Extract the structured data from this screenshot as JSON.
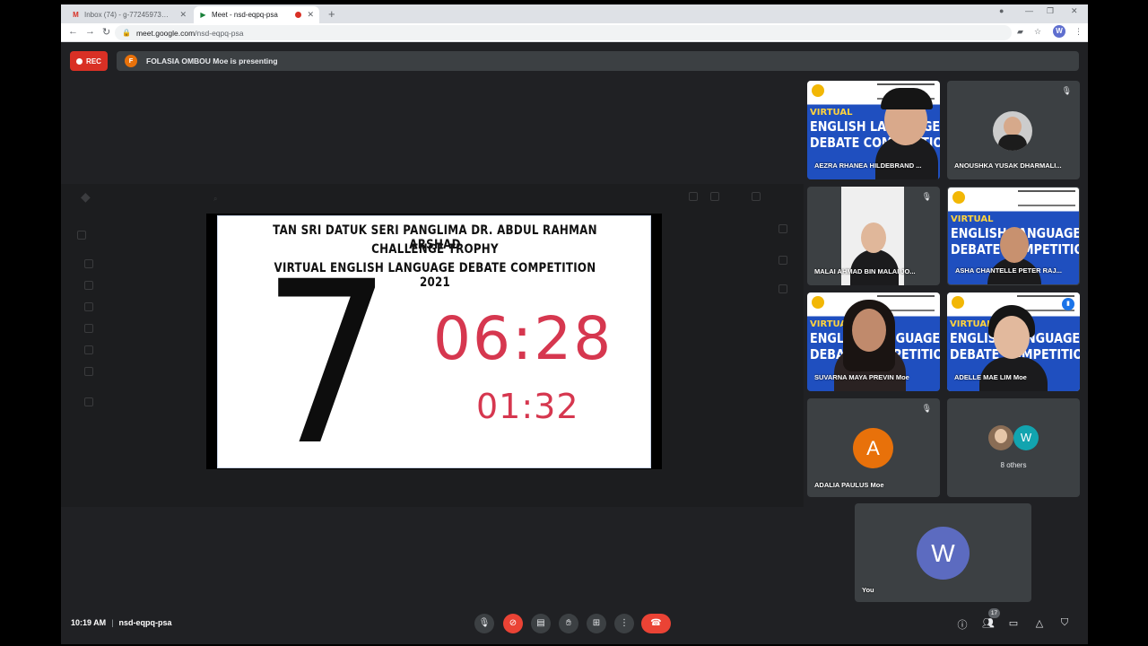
{
  "browser": {
    "tabs": [
      {
        "title": "Inbox (74) - g-77245973@moe-...",
        "favicon": "M"
      },
      {
        "title": "Meet - nsd-eqpq-psa",
        "favicon": "▶"
      }
    ],
    "url_host": "meet.google.com",
    "url_path": "/nsd-eqpq-psa",
    "profile_initial": "W"
  },
  "meet": {
    "rec_label": "REC",
    "presenter_initial": "F",
    "presenting_text": "FOLASIA OMBOU Moe is presenting",
    "meeting_code": "nsd-eqpq-psa",
    "time": "10:19 AM",
    "participant_count": "17"
  },
  "slide": {
    "line1": "TAN SRI DATUK SERI PANGLIMA DR. ABDUL RAHMAN ARSHAD",
    "line2": "CHALLENGE TROPHY",
    "line3": "VIRTUAL ENGLISH LANGUAGE DEBATE COMPETITION 2021",
    "counter": "7",
    "timer_main": "06:28",
    "timer_sub": "01:32"
  },
  "banner": {
    "w1": "VIRTUAL",
    "w2": "ENGLISH LANGUAGE",
    "w3": "DEBATE COMPETITION"
  },
  "participants": [
    {
      "name": "AEZRA RHANEA HILDEBRAND ..."
    },
    {
      "name": "ANOUSHKA YUSAK DHARMALI..."
    },
    {
      "name": "MALAI AHMAD BIN MALAI JO..."
    },
    {
      "name": "ASHA CHANTELLE PETER RAJ..."
    },
    {
      "name": "SUVARNA MAYA PREVIN Moe"
    },
    {
      "name": "ADELLE MAE LIM Moe"
    },
    {
      "name": "ADALIA PAULUS Moe",
      "initial": "A"
    },
    {
      "name": "8 others",
      "initial": "W"
    },
    {
      "name": "You",
      "initial": "W"
    }
  ],
  "colors": {
    "rec_red": "#d93025",
    "timer_red": "#d6374f",
    "tile_bg": "#3c4043",
    "avatar_orange": "#e8710a",
    "avatar_purple": "#5c6bc0",
    "avatar_teal": "#12a4af"
  },
  "icons": [
    "mic-icon",
    "camera-off-icon",
    "captions-icon",
    "raise-hand-icon",
    "present-icon",
    "more-icon",
    "hangup-icon",
    "info-icon",
    "people-icon",
    "chat-icon",
    "activities-icon",
    "host-controls-icon"
  ]
}
